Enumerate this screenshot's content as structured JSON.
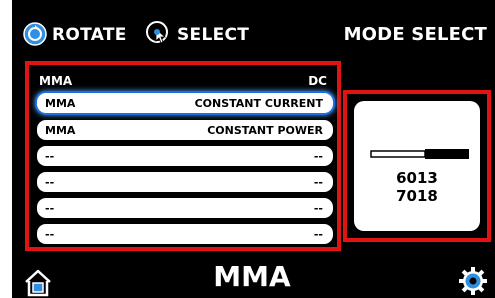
{
  "topbar": {
    "rotate_label": "ROTATE",
    "select_label": "SELECT",
    "title": "MODE SELECT",
    "rotate_icon": "rotate-knob-icon",
    "select_icon": "press-select-icon"
  },
  "list": {
    "header": {
      "left": "MMA",
      "right": "DC"
    },
    "rows": [
      {
        "left": "MMA",
        "right": "CONSTANT CURRENT",
        "selected": true
      },
      {
        "left": "MMA",
        "right": "CONSTANT POWER",
        "selected": false
      },
      {
        "left": "--",
        "right": "--",
        "selected": false
      },
      {
        "left": "--",
        "right": "--",
        "selected": false
      },
      {
        "left": "--",
        "right": "--",
        "selected": false
      },
      {
        "left": "--",
        "right": "--",
        "selected": false
      }
    ]
  },
  "info": {
    "electrode_icon": "electrode-icon",
    "classes": [
      "6013",
      "7018"
    ]
  },
  "footer": {
    "title": "MMA",
    "home_icon": "home-icon",
    "settings_icon": "gear-icon"
  },
  "colors": {
    "background": "#000000",
    "highlight_frame": "#e11414",
    "selection_glow": "#4aa0ff",
    "icon_blue": "#2f8fe0"
  }
}
